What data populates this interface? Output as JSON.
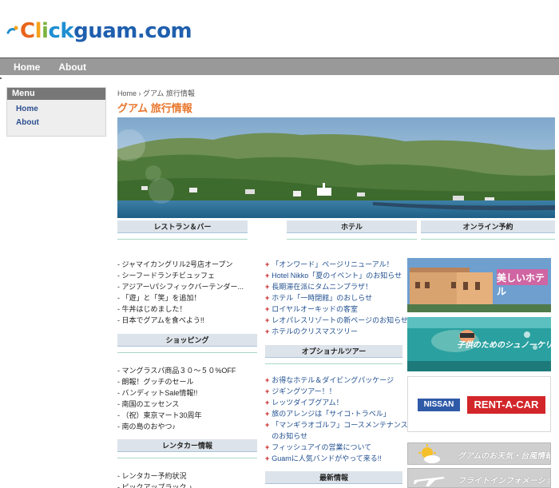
{
  "logo": {
    "part1": "C",
    "part2": "l",
    "part3": "i",
    "part4": "ck",
    "part5": "guam.com"
  },
  "nav": {
    "items": [
      "Home",
      "About"
    ]
  },
  "menu": {
    "title": "Menu",
    "items": [
      "Home",
      "About"
    ]
  },
  "breadcrumb": "Home › グアム 旅行情報",
  "page_title": "グアム 旅行情報",
  "sections": {
    "restaurant": "レストラン＆バー",
    "hotel": "ホテル",
    "online": "オンライン予約",
    "shopping": "ショッピング",
    "optional_tour": "オプショナルツアー",
    "rentacar": "レンタカー情報",
    "latest": "最新情報"
  },
  "restaurant_items": [
    "- ジャマイカングリル2号店オープン",
    "- シーフードランチビュッフェ",
    "- アジアー\\パシフィックバーテンダー...",
    "- 「遊」と「笑」を追加！",
    "- 牛丼はじめました！",
    "- 日本でグアムを食べよう!!"
  ],
  "hotel_items": [
    "「オンワード」ページリニューアル！",
    "Hotel Nikko「夏のイベント」のお知らせ",
    "長期滞在派にタムニンプラザ！",
    "ホテル「一時閉館」のおしらせ",
    "ロイヤルオーキッドの客室",
    "レオパレスリゾートの新ページのお知らせ",
    "ホテルのクリスマスツリー"
  ],
  "shopping_items": [
    "- マングラスパ商品３０～５０%OFF",
    "- 朗報！グッチのセール",
    "- バンディットSale情報!!",
    "- 南国のエッセンス",
    "- （祝）東京マート30周年",
    "- 南の島のおやつ♪"
  ],
  "tour_items": [
    "お得なホテル＆ダイビングパッケージ",
    "ジギングツアー！！",
    "レッツダイブグアム！",
    "旅のアレンジは「サイコ･トラベル」",
    "「マンギラオゴルフ」コースメンテナンス",
    "のお知らせ",
    "フィッシュアイの営業について",
    "Guamに人気バンドがやって来る!!"
  ],
  "rentacar_items": [
    "- レンタカー予約状況",
    "- ピックアップラック ♪"
  ],
  "ads": {
    "hotel": "美しいホテル",
    "snorkel": "子供のためのシュノーケリング",
    "nissan_brand": "NISSAN",
    "nissan_rent": "RENT-A-CAR",
    "weather": "グアムのお天気・台風情報",
    "flight": "フライトインフォメーション"
  },
  "colors": {
    "nav_bg": "#999999",
    "title_orange": "#e8772e",
    "link_blue": "#1f4e8f",
    "bullet_red": "#c41a1a"
  }
}
